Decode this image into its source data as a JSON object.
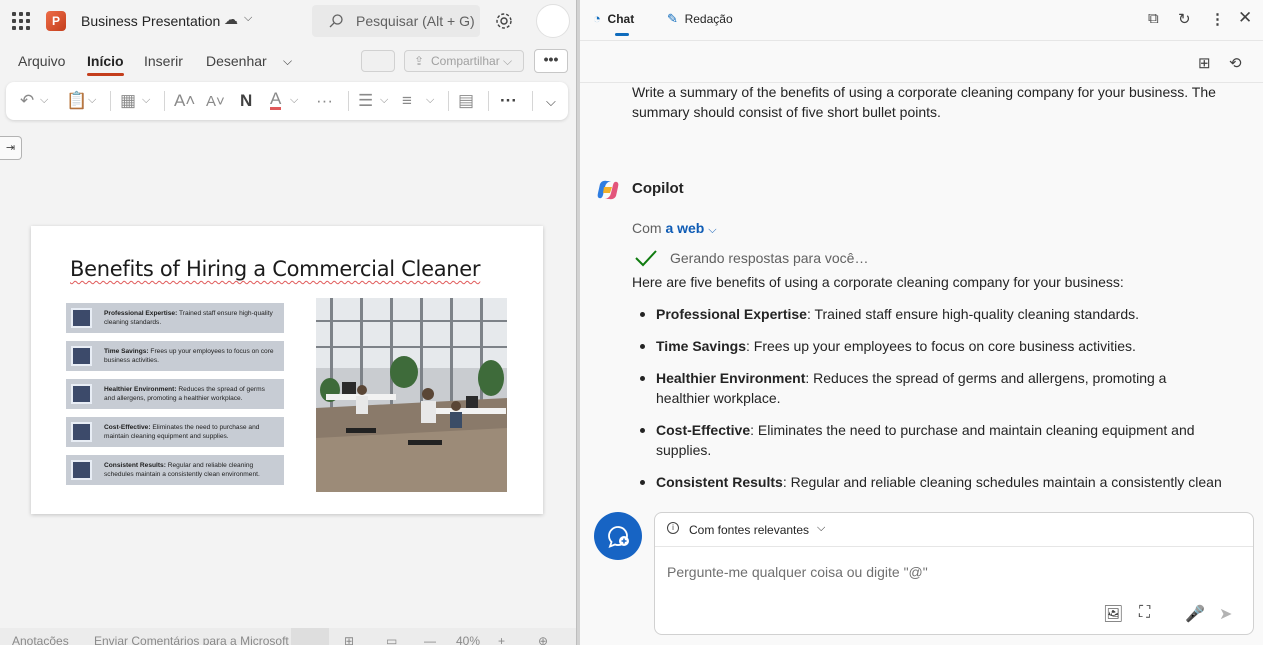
{
  "powerpoint": {
    "app_badge": "P",
    "doc_title": "Business Presentation",
    "search_placeholder": "Pesquisar (Alt + G)",
    "tabs": [
      "Arquivo",
      "Início",
      "Inserir",
      "Desenhar"
    ],
    "active_tab": "Início",
    "share_label": "Compartilhar",
    "more_label": "•••",
    "slide": {
      "title": "Benefits of Hiring a Commercial Cleaner",
      "bullets": [
        {
          "label": "Professional Expertise:",
          "text": " Trained staff ensure high-quality cleaning standards."
        },
        {
          "label": "Time Savings:",
          "text": " Frees up your employees to focus on core business activities."
        },
        {
          "label": "Healthier Environment:",
          "text": " Reduces the spread of germs and allergens, promoting a healthier workplace."
        },
        {
          "label": "Cost-Effective:",
          "text": " Eliminates the need to purchase and maintain cleaning equipment and supplies."
        },
        {
          "label": "Consistent Results:",
          "text": " Regular and reliable cleaning schedules maintain a consistently clean environment."
        }
      ]
    },
    "status": {
      "notes": "Anotações",
      "feedback": "Enviar Comentários para a Microsoft",
      "zoom": "40%",
      "minus": "—",
      "plus": "+"
    }
  },
  "copilot": {
    "tabs": [
      "Chat",
      "Redação"
    ],
    "active_tab": "Chat",
    "user_message": "Write a summary of the benefits of using a corporate cleaning company for your business. The summary should consist of five short bullet points.",
    "assistant_name": "Copilot",
    "source_prefix": "Com",
    "source_link": "a web",
    "generating": "Gerando respostas para você…",
    "intro": "Here are five benefits of using a corporate cleaning company for your business:",
    "bullets": [
      {
        "label": "Professional Expertise",
        "text": ": Trained staff ensure high-quality cleaning standards."
      },
      {
        "label": "Time Savings",
        "text": ": Frees up your employees to focus on core business activities."
      },
      {
        "label": "Healthier Environment",
        "text": ": Reduces the spread of germs and allergens, promoting a healthier workplace."
      },
      {
        "label": "Cost-Effective",
        "text": ": Eliminates the need to purchase and maintain cleaning equipment and supplies."
      },
      {
        "label": "Consistent Results",
        "text": ": Regular and reliable cleaning schedules maintain a consistently clean"
      }
    ],
    "composer": {
      "source_selector": "Com fontes relevantes",
      "placeholder": "Pergunte-me qualquer coisa ou digite \"@\""
    }
  },
  "colors": {
    "ppt_accent": "#c43e1c",
    "copilot_accent": "#0f6cbd",
    "new_chat": "#1764c4",
    "link": "#0f5cb5"
  }
}
